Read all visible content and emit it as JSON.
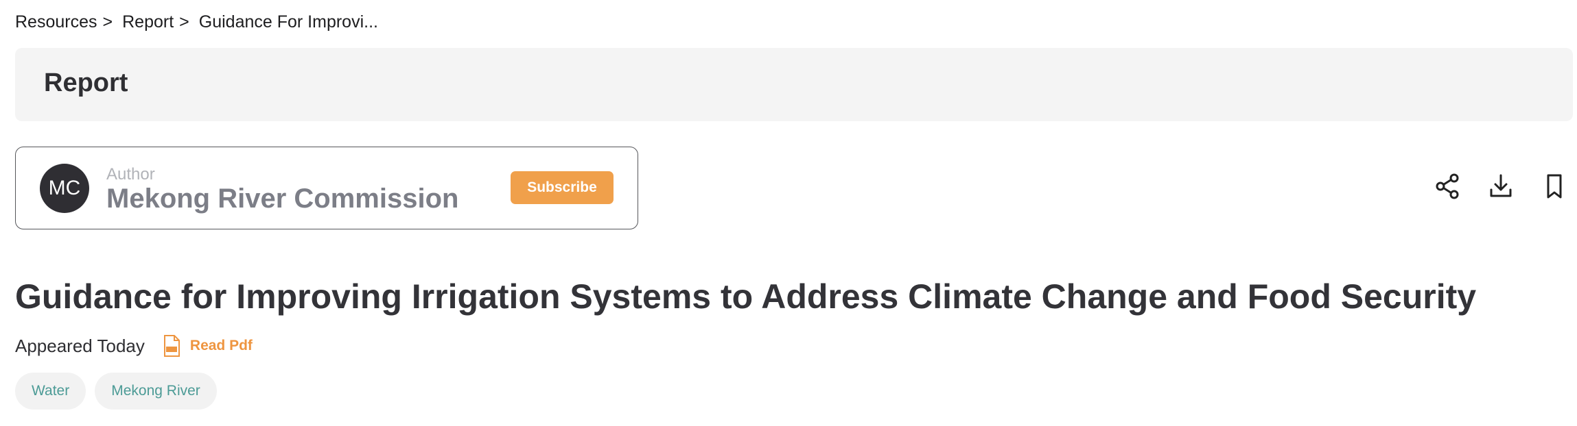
{
  "breadcrumb": {
    "items": [
      {
        "label": "Resources",
        "sep": ">"
      },
      {
        "label": "Report",
        "sep": ">"
      },
      {
        "label": "Guidance For Improvi..."
      }
    ]
  },
  "section": {
    "title": "Report"
  },
  "author": {
    "initials": "MC",
    "caption": "Author",
    "name": "Mekong River Commission",
    "subscribe_label": "Subscribe"
  },
  "actions": {
    "icons": [
      "share-icon",
      "download-icon",
      "bookmark-icon"
    ]
  },
  "document": {
    "title": "Guidance for Improving Irrigation Systems to Address Climate Change and Food Security",
    "appeared": "Appeared Today",
    "pdf_label": "Read Pdf"
  },
  "tags": [
    "Water",
    "Mekong River"
  ],
  "colors": {
    "accent_orange": "#f0a04b",
    "tag_text": "#4c9b96",
    "banner_bg": "#f4f4f4",
    "avatar_bg": "#2f2e33"
  }
}
